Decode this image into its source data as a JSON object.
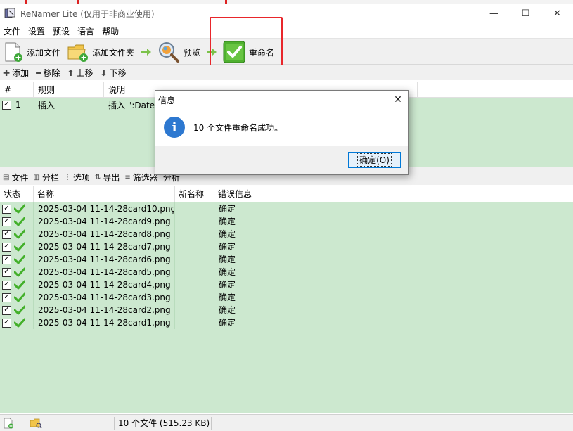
{
  "window": {
    "title": "ReNamer Lite (仅用于非商业使用)",
    "minimize": "—",
    "maximize": "☐",
    "close": "✕"
  },
  "menu": [
    "文件",
    "设置",
    "预设",
    "语言",
    "帮助"
  ],
  "toolbar": {
    "add_files": "添加文件",
    "add_folders": "添加文件夹",
    "preview": "预览",
    "rename": "重命名"
  },
  "rules_toolbar": {
    "add": "添加",
    "remove": "移除",
    "up": "上移",
    "down": "下移"
  },
  "rules_table": {
    "headers": [
      "#",
      "规则",
      "说明"
    ],
    "rows": [
      {
        "num": "1",
        "rule": "插入",
        "desc": "插入 \":Date_"
      }
    ]
  },
  "files_toolbar": {
    "files": "文件",
    "columns": "分栏",
    "options": "选项",
    "export": "导出",
    "filters": "筛选器",
    "analyze": "分析"
  },
  "files_table": {
    "headers": [
      "状态",
      "名称",
      "新名称",
      "错误信息"
    ],
    "rows": [
      {
        "name": "2025-03-04 11-14-28card10.png",
        "new_name": "",
        "error": "确定"
      },
      {
        "name": "2025-03-04 11-14-28card9.png",
        "new_name": "",
        "error": "确定"
      },
      {
        "name": "2025-03-04 11-14-28card8.png",
        "new_name": "",
        "error": "确定"
      },
      {
        "name": "2025-03-04 11-14-28card7.png",
        "new_name": "",
        "error": "确定"
      },
      {
        "name": "2025-03-04 11-14-28card6.png",
        "new_name": "",
        "error": "确定"
      },
      {
        "name": "2025-03-04 11-14-28card5.png",
        "new_name": "",
        "error": "确定"
      },
      {
        "name": "2025-03-04 11-14-28card4.png",
        "new_name": "",
        "error": "确定"
      },
      {
        "name": "2025-03-04 11-14-28card3.png",
        "new_name": "",
        "error": "确定"
      },
      {
        "name": "2025-03-04 11-14-28card2.png",
        "new_name": "",
        "error": "确定"
      },
      {
        "name": "2025-03-04 11-14-28card1.png",
        "new_name": "",
        "error": "确定"
      }
    ]
  },
  "status_bar": {
    "summary": "10 个文件 (515.23 KB)"
  },
  "dialog": {
    "title": "信息",
    "message": "10 个文件重命名成功。",
    "ok_button": "确定(O)",
    "close": "✕"
  },
  "colors": {
    "row_green": "#cce8cf",
    "highlight_red": "#e8262b",
    "info_blue": "#2d78d0",
    "check_green": "#43b02a"
  },
  "icons": {
    "app": "renamer-app-icon",
    "add_files": "add-file-icon",
    "add_folders": "add-folder-icon",
    "preview": "magnifier-preview-icon",
    "rename": "green-check-rename-icon",
    "info": "info-icon"
  }
}
